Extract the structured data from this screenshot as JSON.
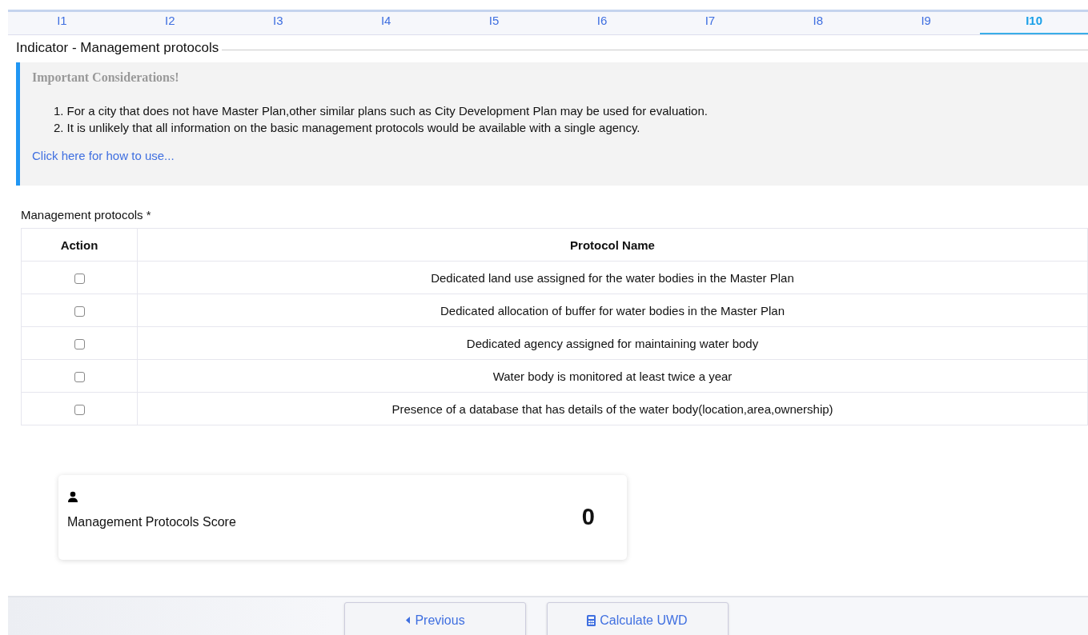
{
  "tabs": [
    {
      "label": "I1",
      "selected": false
    },
    {
      "label": "I2",
      "selected": false
    },
    {
      "label": "I3",
      "selected": false
    },
    {
      "label": "I4",
      "selected": false
    },
    {
      "label": "I5",
      "selected": false
    },
    {
      "label": "I6",
      "selected": false
    },
    {
      "label": "I7",
      "selected": false
    },
    {
      "label": "I8",
      "selected": false
    },
    {
      "label": "I9",
      "selected": false
    },
    {
      "label": "I10",
      "selected": true
    }
  ],
  "section_title": "Indicator - Management protocols",
  "considerations": {
    "title": "Important Considerations!",
    "items": [
      {
        "marker": "1.",
        "text": "For a city that does not have Master Plan,other similar plans such as City Development Plan may be used for evaluation."
      },
      {
        "marker": "2.",
        "text": "It is unlikely that all information on the basic management protocols would be available with a single agency."
      }
    ],
    "link": "Click here for how to use..."
  },
  "table": {
    "label": "Management protocols *",
    "columns": [
      "Action",
      "Protocol Name"
    ],
    "rows": [
      {
        "checked": false,
        "name": "Dedicated land use assigned for the water bodies in the Master Plan"
      },
      {
        "checked": false,
        "name": "Dedicated allocation of buffer for water bodies in the Master Plan"
      },
      {
        "checked": false,
        "name": "Dedicated agency assigned for maintaining water body"
      },
      {
        "checked": false,
        "name": "Water body is monitored at least twice a year"
      },
      {
        "checked": false,
        "name": "Presence of a database that has details of the water body(location,area,ownership)"
      }
    ]
  },
  "score": {
    "label": "Management Protocols Score",
    "value": "0"
  },
  "buttons": [
    {
      "kind": "previous",
      "label": "Previous"
    },
    {
      "kind": "calculate",
      "label": "Calculate UWD"
    }
  ]
}
